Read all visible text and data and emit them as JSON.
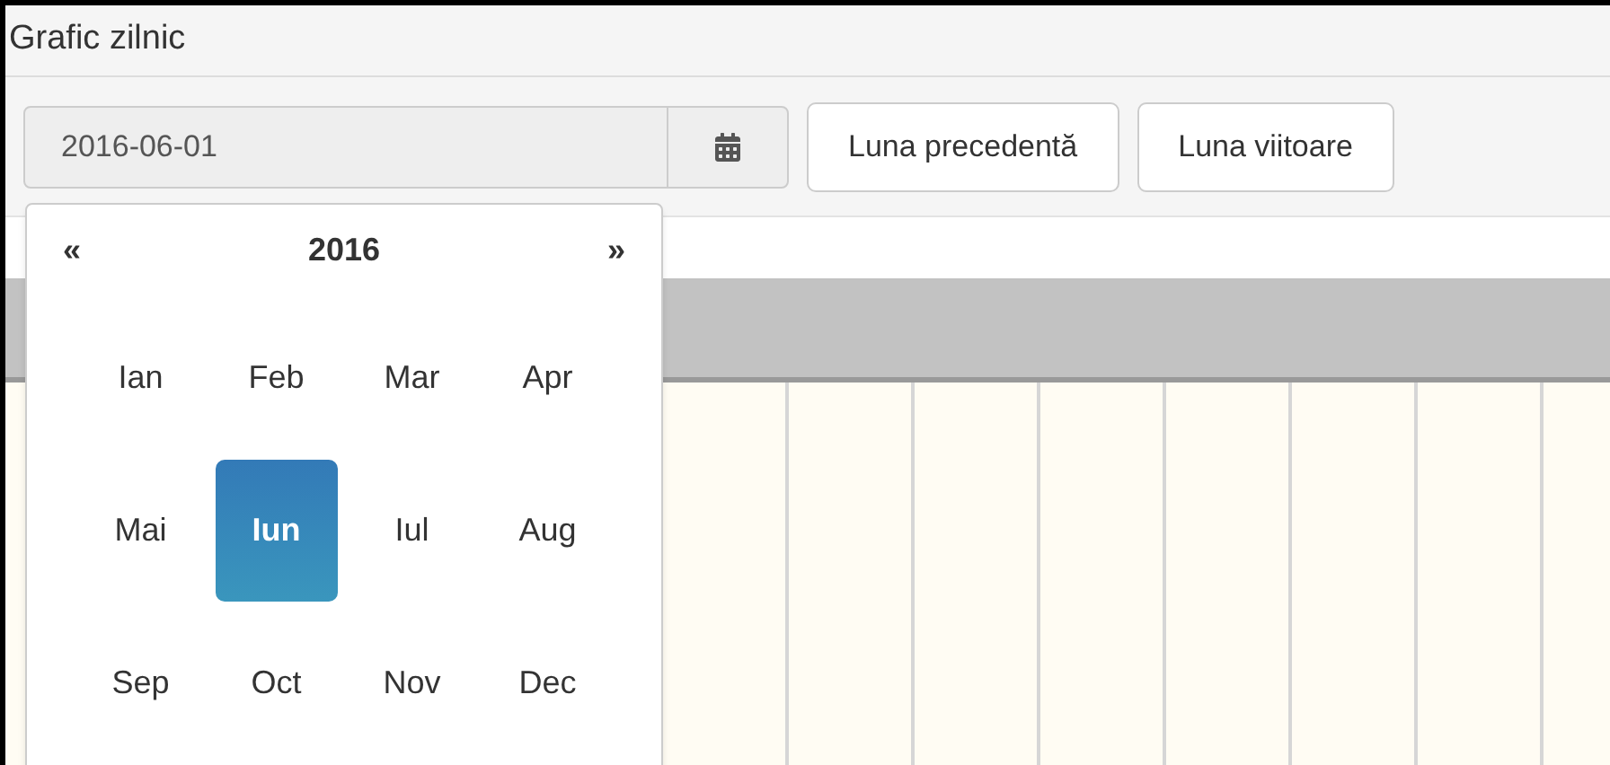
{
  "panel": {
    "title": "Grafic zilnic"
  },
  "toolbar": {
    "date_value": "2016-06-01",
    "buttons": [
      "Luna precedentă",
      "Luna viitoare"
    ]
  },
  "datepicker": {
    "prev": "«",
    "year": "2016",
    "next": "»",
    "months": [
      {
        "label": "Ian",
        "selected": false
      },
      {
        "label": "Feb",
        "selected": false
      },
      {
        "label": "Mar",
        "selected": false
      },
      {
        "label": "Apr",
        "selected": false
      },
      {
        "label": "Mai",
        "selected": false
      },
      {
        "label": "Iun",
        "selected": true
      },
      {
        "label": "Iul",
        "selected": false
      },
      {
        "label": "Aug",
        "selected": false
      },
      {
        "label": "Sep",
        "selected": false
      },
      {
        "label": "Oct",
        "selected": false
      },
      {
        "label": "Nov",
        "selected": false
      },
      {
        "label": "Dec",
        "selected": false
      }
    ]
  }
}
